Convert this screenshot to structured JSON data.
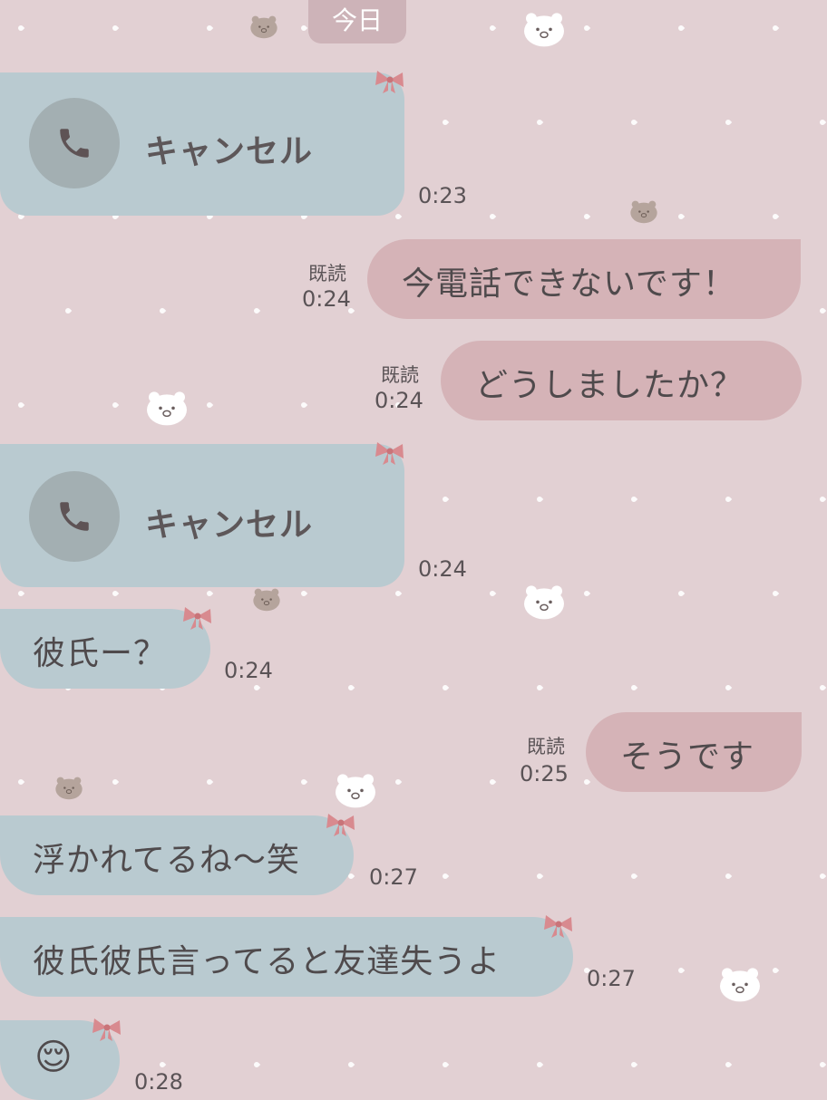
{
  "header": {
    "date_label": "今日"
  },
  "messages": [
    {
      "kind": "call",
      "label": "キャンセル",
      "time": "0:23",
      "icon": "phone-icon"
    },
    {
      "kind": "text",
      "side": "out",
      "text": "今電話できないです！",
      "read": "既読",
      "time": "0:24"
    },
    {
      "kind": "text",
      "side": "out",
      "text": "どうしましたか？",
      "read": "既読",
      "time": "0:24"
    },
    {
      "kind": "call",
      "label": "キャンセル",
      "time": "0:24",
      "icon": "phone-icon"
    },
    {
      "kind": "text",
      "side": "in",
      "text": "彼氏ー？",
      "time": "0:24"
    },
    {
      "kind": "text",
      "side": "out",
      "text": "そうです",
      "read": "既読",
      "time": "0:25"
    },
    {
      "kind": "text",
      "side": "in",
      "text": "浮かれてるね〜笑",
      "time": "0:27"
    },
    {
      "kind": "text",
      "side": "in",
      "text": "彼氏彼氏言ってると友達失うよ",
      "time": "0:27"
    },
    {
      "kind": "emoji",
      "side": "in",
      "text": "😌",
      "time": "0:28"
    }
  ],
  "colors": {
    "background": "#e2d0d3",
    "incoming_bubble": "#b9cad0",
    "outgoing_bubble": "#d5b3b7",
    "bow": "#d88a8f"
  }
}
